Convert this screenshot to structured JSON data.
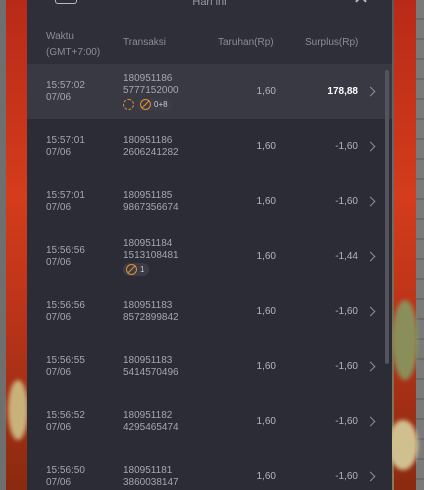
{
  "modal": {
    "title": "Hari ini"
  },
  "table": {
    "headers": {
      "time_line1": "Waktu",
      "time_line2": "(GMT+7:00)",
      "transaction": "Transaksi",
      "bet": "Taruhan(Rp)",
      "surplus": "Surplus(Rp)"
    },
    "rows": [
      {
        "time": "15:57:02",
        "date": "07/06",
        "tx1": "180951186",
        "tx2": "5777152000",
        "bet": "1,60",
        "surplus": "178,88",
        "badge": "0+8",
        "highlight": true
      },
      {
        "time": "15:57:01",
        "date": "07/06",
        "tx1": "180951186",
        "tx2": "2606241282",
        "bet": "1,60",
        "surplus": "-1,60",
        "badge": "",
        "highlight": false
      },
      {
        "time": "15:57:01",
        "date": "07/06",
        "tx1": "180951185",
        "tx2": "9867356674",
        "bet": "1,60",
        "surplus": "-1,60",
        "badge": "",
        "highlight": false
      },
      {
        "time": "15:56:56",
        "date": "07/06",
        "tx1": "180951184",
        "tx2": "1513108481",
        "bet": "1,60",
        "surplus": "-1,44",
        "badge": "1",
        "highlight": false
      },
      {
        "time": "15:56:56",
        "date": "07/06",
        "tx1": "180951183",
        "tx2": "8572899842",
        "bet": "1,60",
        "surplus": "-1,60",
        "badge": "",
        "highlight": false
      },
      {
        "time": "15:56:55",
        "date": "07/06",
        "tx1": "180951183",
        "tx2": "5414570496",
        "bet": "1,60",
        "surplus": "-1,60",
        "badge": "",
        "highlight": false
      },
      {
        "time": "15:56:52",
        "date": "07/06",
        "tx1": "180951182",
        "tx2": "4295465474",
        "bet": "1,60",
        "surplus": "-1,60",
        "badge": "",
        "highlight": false
      },
      {
        "time": "15:56:50",
        "date": "07/06",
        "tx1": "180951181",
        "tx2": "3860038147",
        "bet": "1,60",
        "surplus": "-1,60",
        "badge": "",
        "highlight": false
      }
    ]
  },
  "colors": {
    "modal_bg": "#2c2c36",
    "highlight_row": "#393944",
    "accent_orange": "#e0902a",
    "side_red": "#d43c1c"
  }
}
